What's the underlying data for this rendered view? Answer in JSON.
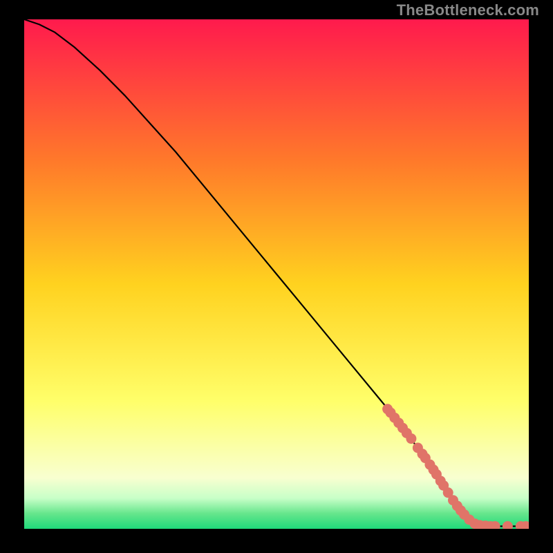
{
  "watermark": "TheBottleneck.com",
  "colors": {
    "gradient_top": "#ff1a4d",
    "gradient_upper_mid": "#ff7a2a",
    "gradient_mid": "#ffd21f",
    "gradient_lower_mid": "#ffff6a",
    "gradient_near_bottom": "#f8ffd0",
    "gradient_bottom_band1": "#c8ffc8",
    "gradient_bottom_band2": "#66e68c",
    "gradient_bottom": "#1fd97a",
    "curve": "#000000",
    "marker": "#e07468",
    "frame": "#000000"
  },
  "chart_data": {
    "type": "line",
    "title": "",
    "xlabel": "",
    "ylabel": "",
    "xlim": [
      0,
      100
    ],
    "ylim": [
      0,
      100
    ],
    "series": [
      {
        "name": "curve",
        "x": [
          0,
          3,
          6,
          10,
          15,
          20,
          25,
          30,
          35,
          40,
          45,
          50,
          55,
          60,
          65,
          70,
          75,
          80,
          83,
          86,
          88,
          90,
          92,
          94,
          96,
          98,
          100
        ],
        "y": [
          100,
          99,
          97.5,
          94.5,
          90,
          85,
          79.5,
          74,
          68,
          62,
          56,
          50,
          44,
          38,
          32,
          26,
          20,
          13,
          8,
          4,
          2,
          1,
          0.6,
          0.5,
          0.5,
          0.5,
          0.5
        ]
      }
    ],
    "markers": [
      {
        "x": 72.0,
        "y": 23.5
      },
      {
        "x": 72.6,
        "y": 22.8
      },
      {
        "x": 73.4,
        "y": 21.8
      },
      {
        "x": 74.2,
        "y": 20.8
      },
      {
        "x": 75.0,
        "y": 19.8
      },
      {
        "x": 75.8,
        "y": 18.8
      },
      {
        "x": 76.7,
        "y": 17.7
      },
      {
        "x": 78.0,
        "y": 15.9
      },
      {
        "x": 78.9,
        "y": 14.7
      },
      {
        "x": 79.5,
        "y": 13.9
      },
      {
        "x": 80.4,
        "y": 12.6
      },
      {
        "x": 81.1,
        "y": 11.6
      },
      {
        "x": 81.7,
        "y": 10.7
      },
      {
        "x": 82.5,
        "y": 9.4
      },
      {
        "x": 83.1,
        "y": 8.5
      },
      {
        "x": 84.0,
        "y": 7.1
      },
      {
        "x": 85.0,
        "y": 5.6
      },
      {
        "x": 85.8,
        "y": 4.5
      },
      {
        "x": 86.5,
        "y": 3.6
      },
      {
        "x": 87.2,
        "y": 2.8
      },
      {
        "x": 88.2,
        "y": 1.8
      },
      {
        "x": 89.3,
        "y": 1.0
      },
      {
        "x": 90.3,
        "y": 0.7
      },
      {
        "x": 91.4,
        "y": 0.6
      },
      {
        "x": 92.4,
        "y": 0.5
      },
      {
        "x": 93.3,
        "y": 0.5
      },
      {
        "x": 95.8,
        "y": 0.5
      },
      {
        "x": 98.4,
        "y": 0.5
      },
      {
        "x": 99.4,
        "y": 0.5
      }
    ]
  }
}
